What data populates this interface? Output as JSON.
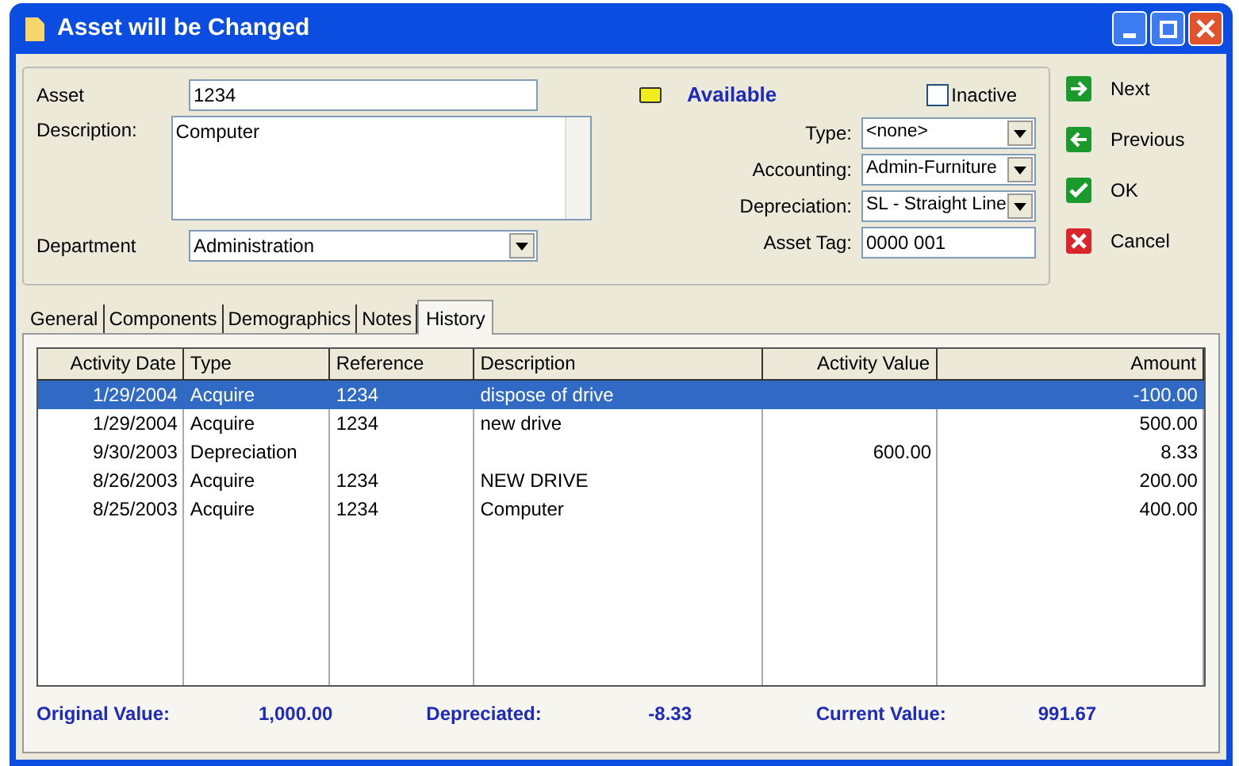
{
  "window": {
    "title": "Asset will be Changed"
  },
  "asset": {
    "label": "Asset",
    "value": "1234"
  },
  "description": {
    "label": "Description:",
    "value": "Computer"
  },
  "department": {
    "label": "Department",
    "value": "Administration"
  },
  "status": {
    "text": "Available"
  },
  "inactive": {
    "label": "Inactive",
    "checked": false
  },
  "right_fields": [
    {
      "kind": "dropdown",
      "label": "Type:",
      "value": "<none>"
    },
    {
      "kind": "dropdown",
      "label": "Accounting:",
      "value": "Admin-Furniture"
    },
    {
      "kind": "dropdown",
      "label": "Depreciation:",
      "value": "SL - Straight Line"
    },
    {
      "kind": "text",
      "label": "Asset Tag:",
      "value": "0000 001"
    }
  ],
  "actions": [
    {
      "kind": "next",
      "label": "Next"
    },
    {
      "kind": "previous",
      "label": "Previous"
    },
    {
      "kind": "ok",
      "label": "OK"
    },
    {
      "kind": "cancel",
      "label": "Cancel"
    }
  ],
  "tabs": [
    {
      "label": "General",
      "selected": false
    },
    {
      "label": "Components",
      "selected": false
    },
    {
      "label": "Demographics",
      "selected": false
    },
    {
      "label": "Notes",
      "selected": false
    },
    {
      "label": "History",
      "selected": true
    }
  ],
  "table": {
    "columns": [
      "Activity Date",
      "Type",
      "Reference",
      "Description",
      "Activity Value",
      "Amount"
    ],
    "rows": [
      {
        "selected": true,
        "cells": [
          "1/29/2004",
          "Acquire",
          "1234",
          "dispose of drive",
          "",
          "-100.00"
        ]
      },
      {
        "selected": false,
        "cells": [
          "1/29/2004",
          "Acquire",
          "1234",
          "new drive",
          "",
          "500.00"
        ]
      },
      {
        "selected": false,
        "cells": [
          "9/30/2003",
          "Depreciation",
          "",
          "",
          "600.00",
          "8.33"
        ]
      },
      {
        "selected": false,
        "cells": [
          "8/26/2003",
          "Acquire",
          "1234",
          "NEW DRIVE",
          "",
          "200.00"
        ]
      },
      {
        "selected": false,
        "cells": [
          "8/25/2003",
          "Acquire",
          "1234",
          "Computer",
          "",
          "400.00"
        ]
      }
    ]
  },
  "summary": [
    {
      "label": "Original Value:",
      "value": "1,000.00"
    },
    {
      "label": "Depreciated:",
      "value": "-8.33"
    },
    {
      "label": "Current Value:",
      "value": "991.67"
    }
  ]
}
